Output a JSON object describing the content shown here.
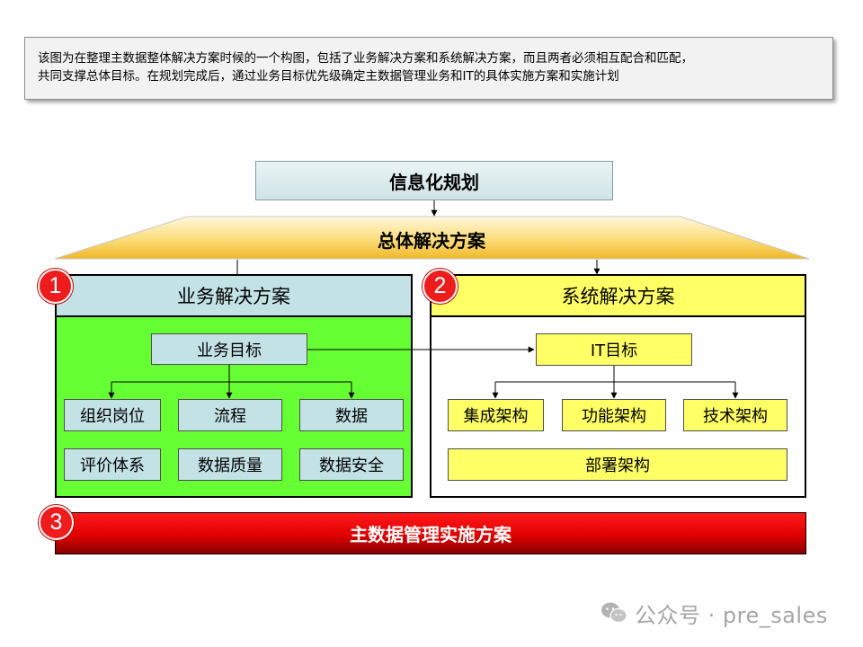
{
  "intro": {
    "line1": "该图为在整理主数据整体解决方案时候的一个构图，包括了业务解决方案和系统解决方案，而且两者必须相互配合和匹配，",
    "line2": "共同支撑总体目标。在规划完成后，通过业务目标优先级确定主数据管理业务和IT的具体实施方案和实施计划"
  },
  "diagram": {
    "planning": "信息化规划",
    "overall_solution": "总体解决方案",
    "business": {
      "badge": "1",
      "title": "业务解决方案",
      "goal": "业务目标",
      "items": [
        "组织岗位",
        "流程",
        "数据",
        "评价体系",
        "数据质量",
        "数据安全"
      ]
    },
    "system": {
      "badge": "2",
      "title": "系统解决方案",
      "goal": "IT目标",
      "items": [
        "集成架构",
        "功能架构",
        "技术架构"
      ],
      "deployment": "部署架构"
    },
    "implementation": {
      "badge": "3",
      "title": "主数据管理实施方案"
    }
  },
  "watermark": {
    "text": "公众号 · pre_sales",
    "icon": "wechat-icon"
  },
  "colors": {
    "blue_box": "#c3e2e5",
    "yellow_box": "#ffff66",
    "green_panel": "#66ff33",
    "red_badge": "#ee1c1c",
    "trapezoid_gold": "#f3c23e"
  }
}
